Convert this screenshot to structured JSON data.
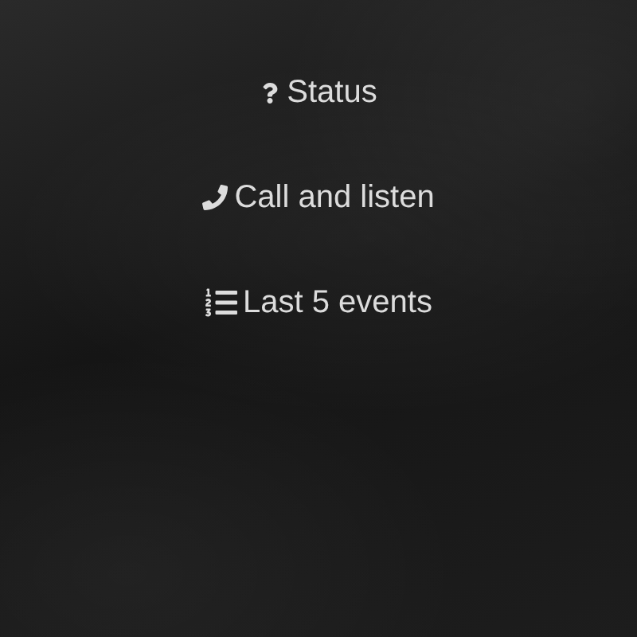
{
  "menu": [
    {
      "kind": "status",
      "label": "Status"
    },
    {
      "kind": "call",
      "label": "Call and listen"
    },
    {
      "kind": "events",
      "label": "Last 5 events"
    }
  ]
}
